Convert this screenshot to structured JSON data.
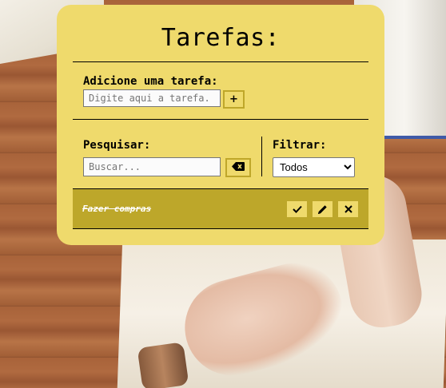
{
  "app": {
    "title": "Tarefas:"
  },
  "add_section": {
    "label": "Adicione uma tarefa:",
    "input_placeholder": "Digite aqui a tarefa.",
    "add_button_label": "+"
  },
  "search_section": {
    "label": "Pesquisar:",
    "input_placeholder": "Buscar...",
    "clear_icon": "backspace-icon"
  },
  "filter_section": {
    "label": "Filtrar:",
    "selected": "Todos"
  },
  "todos": [
    {
      "text": "Fazer compras",
      "done": true,
      "actions": [
        "check-icon",
        "pencil-icon",
        "close-icon"
      ]
    }
  ],
  "colors": {
    "card": "#efda6c",
    "todo_row": "#bda72a",
    "button_border": "#bfa72a"
  }
}
